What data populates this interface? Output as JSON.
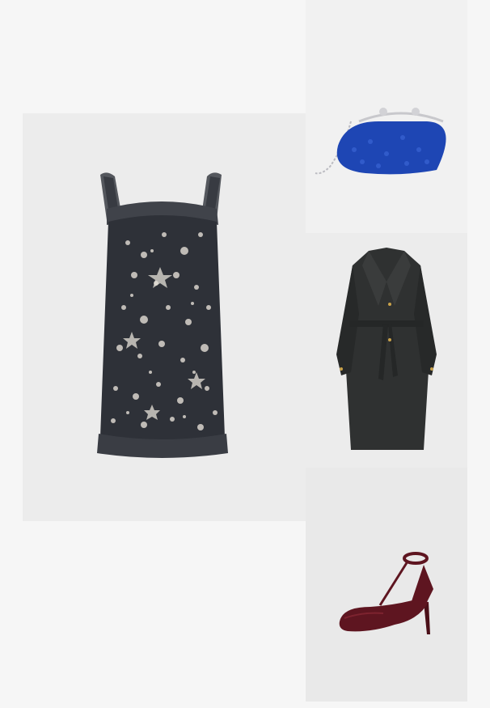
{
  "outfit": {
    "items": [
      {
        "id": "dress",
        "icon": "sequin-dress-image",
        "colors": {
          "primary": "#2e3138",
          "accent": "#d9d4cc"
        }
      },
      {
        "id": "clutch",
        "icon": "beaded-clutch-image",
        "colors": {
          "primary": "#1e46b4",
          "accent": "#c8c8cc"
        }
      },
      {
        "id": "coat",
        "icon": "belted-coat-image",
        "colors": {
          "primary": "#2f3131",
          "accent": "#c9a24a"
        }
      },
      {
        "id": "shoe",
        "icon": "tstrap-pump-image",
        "colors": {
          "primary": "#5e1520",
          "accent": "#8a2a36"
        }
      }
    ]
  },
  "colors": {
    "page_background": "#f6f6f6",
    "tile_background": "#ececec"
  }
}
